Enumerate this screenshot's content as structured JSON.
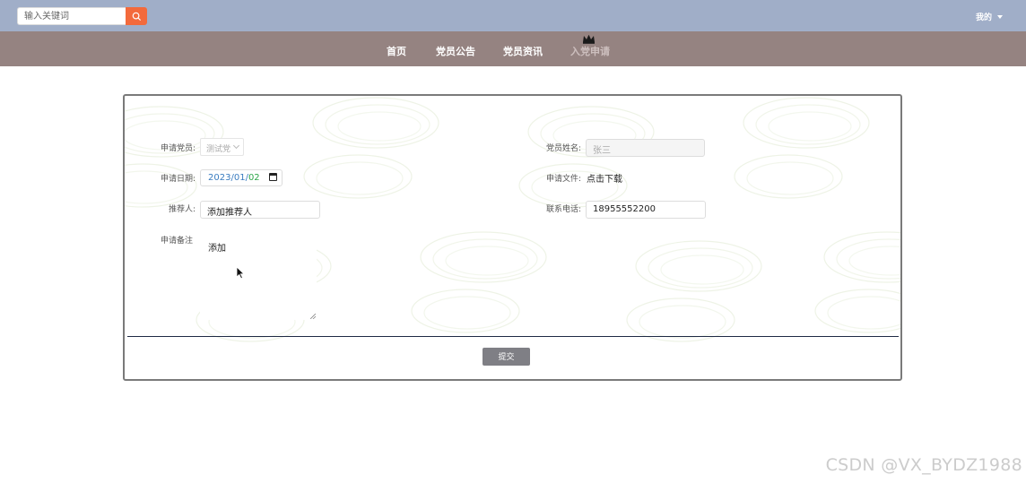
{
  "topbar": {
    "search_placeholder": "输入关键词",
    "search_icon": "search-icon",
    "mine_label": "我的"
  },
  "nav": {
    "items": [
      {
        "label": "首页"
      },
      {
        "label": "党员公告"
      },
      {
        "label": "党员资讯"
      },
      {
        "label": "入党申请",
        "active": true
      }
    ]
  },
  "form": {
    "apply_member_label": "申请党员:",
    "apply_member_value": "测试党",
    "member_name_label": "党员姓名:",
    "member_name_value": "张三",
    "apply_date_label": "申请日期:",
    "apply_date": {
      "year": "2023",
      "month": "01",
      "day": "02"
    },
    "apply_file_label": "申请文件:",
    "apply_file_link": "点击下载",
    "recommender_label": "推荐人:",
    "recommender_value": "添加推荐人",
    "phone_label": "联系电话:",
    "phone_value": "18955552200",
    "remark_label": "申请备注",
    "remark_value": "添加",
    "submit_label": "提交"
  },
  "watermark": "CSDN @VX_BYDZ1988",
  "colors": {
    "topbar": "#a0aec8",
    "navbar": "#958381",
    "search_button": "#f36a3c",
    "submit_button": "#7f7f85"
  }
}
